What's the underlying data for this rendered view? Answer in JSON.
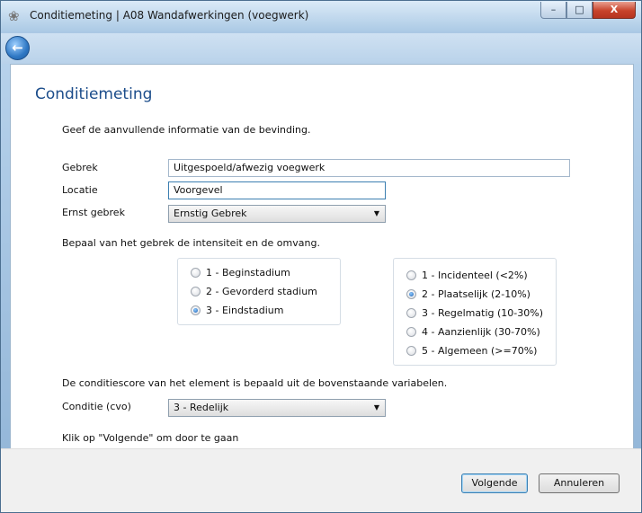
{
  "window": {
    "title": "Conditiemeting | A08 Wandafwerkingen (voegwerk)",
    "app_icon": "app-icon",
    "controls": {
      "minimize": "–",
      "maximize": "□",
      "close": "X"
    }
  },
  "nav": {
    "back_icon": "back-arrow-icon",
    "back_glyph": "←"
  },
  "page": {
    "heading": "Conditiemeting",
    "intro": "Geef de aanvullende informatie van de bevinding."
  },
  "form": {
    "gebrek": {
      "label": "Gebrek",
      "value": "Uitgespoeld/afwezig voegwerk"
    },
    "locatie": {
      "label": "Locatie",
      "value": "Voorgevel"
    },
    "ernst": {
      "label": "Ernst gebrek",
      "value": "Ernstig Gebrek"
    }
  },
  "intensity": {
    "instruction": "Bepaal van het gebrek de intensiteit en de omvang.",
    "options": [
      "1 - Beginstadium",
      "2 - Gevorderd stadium",
      "3 - Eindstadium"
    ],
    "selected": "3 - Eindstadium"
  },
  "extent": {
    "options": [
      "1 - Incidenteel (<2%)",
      "2 - Plaatselijk (2-10%)",
      "3 - Regelmatig (10-30%)",
      "4 - Aanzienlijk (30-70%)",
      "5 - Algemeen (>=70%)"
    ],
    "selected": "2 - Plaatselijk (2-10%)"
  },
  "condition": {
    "note": "De conditiescore van het element is bepaald uit de bovenstaande variabelen.",
    "label": "Conditie (cvo)",
    "value": "3 - Redelijk",
    "hint": "Klik op \"Volgende\" om door te gaan"
  },
  "footer": {
    "next_label": "Volgende",
    "cancel_label": "Annuleren"
  },
  "icons": {
    "dropdown": "▼"
  }
}
